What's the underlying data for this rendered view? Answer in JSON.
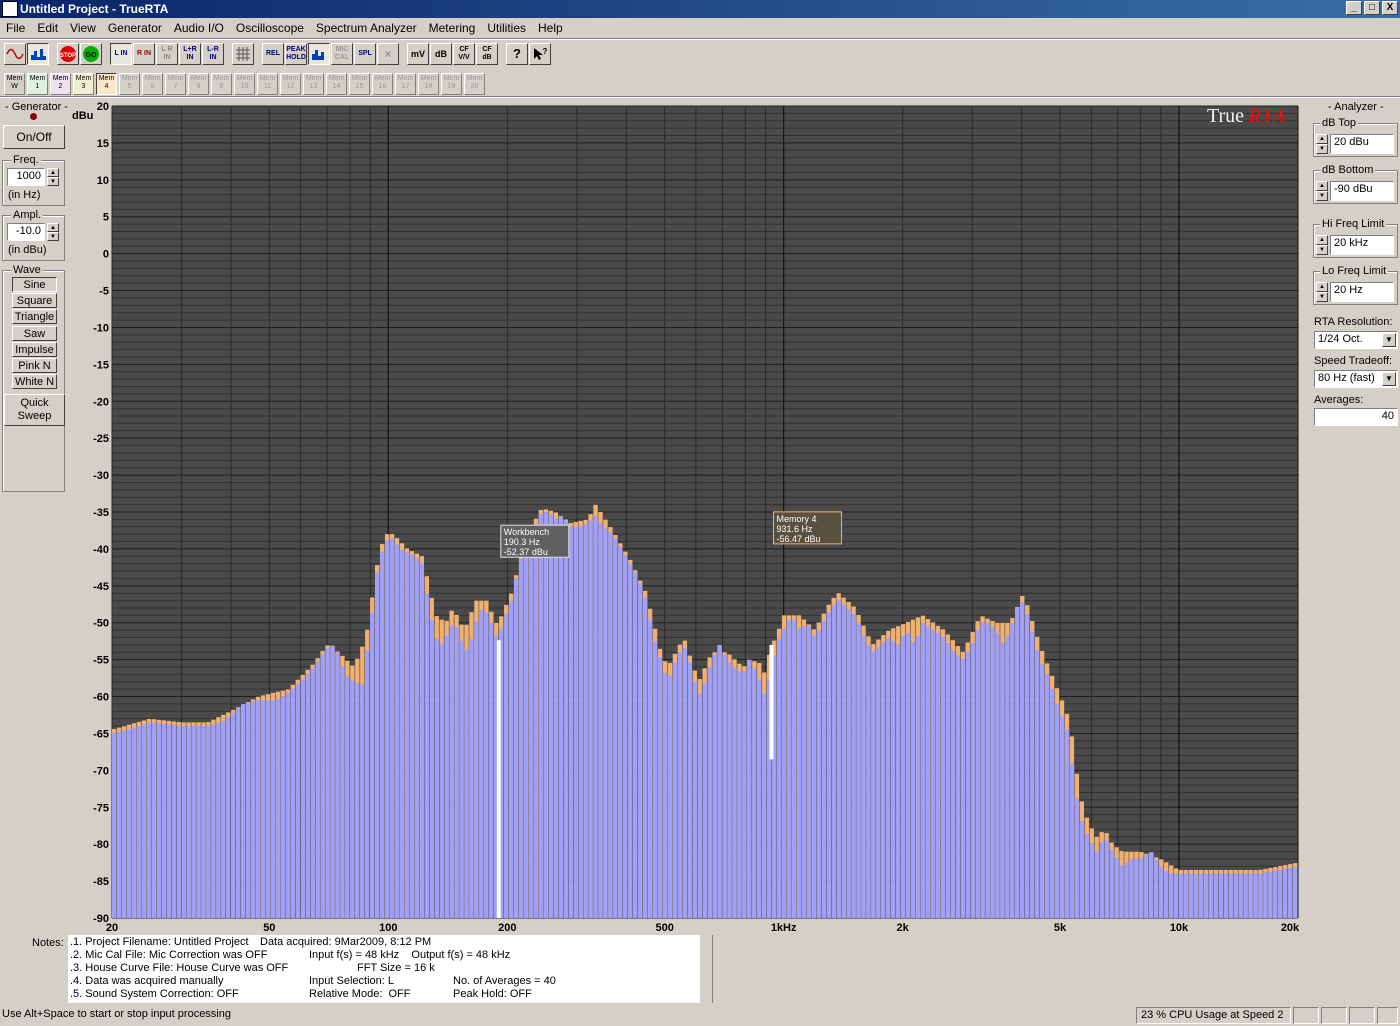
{
  "window": {
    "title": "Untitled Project - TrueRTA",
    "buttons": [
      "_",
      "□",
      "X"
    ]
  },
  "menu": [
    "File",
    "Edit",
    "View",
    "Generator",
    "Audio I/O",
    "Oscilloscope",
    "Spectrum Analyzer",
    "Metering",
    "Utilities",
    "Help"
  ],
  "toolbar": {
    "view_buttons": [
      "sine-wave-icon",
      "spectrum-icon"
    ],
    "control_buttons": [
      "STOP",
      "GO"
    ],
    "input_buttons": [
      "L IN",
      "R IN",
      "L R IN",
      "L+R IN",
      "L-R IN"
    ],
    "grid_button": "grid-icon",
    "mode_buttons": [
      "REL",
      "PEAK HOLD",
      "bars-icon",
      "MIC CAL",
      "SPL",
      "×"
    ],
    "unit_buttons": [
      "mV",
      "dB",
      "CF V/V",
      "CF dB"
    ],
    "help_buttons": [
      "?",
      "help-pointer-icon"
    ]
  },
  "memory_buttons": [
    "Mem W",
    "Mem 1",
    "Mem 2",
    "Mem 3",
    "Mem 4",
    "Mem 5",
    "Mem 6",
    "Mem 7",
    "Mem 8",
    "Mem 9",
    "Mem 10",
    "Mem 11",
    "Mem 12",
    "Mem 13",
    "Mem 14",
    "Mem 15",
    "Mem 16",
    "Mem 17",
    "Mem 18",
    "Mem 19",
    "Mem 20"
  ],
  "generator": {
    "title": "- Generator -",
    "onoff": "On/Off",
    "freq_title": "Freq.",
    "freq_value": "1000",
    "freq_unit": "(in Hz)",
    "ampl_title": "Ampl.",
    "ampl_value": "-10.0",
    "ampl_unit": "(in dBu)",
    "wave_title": "Wave",
    "waves": [
      "Sine",
      "Square",
      "Triangle",
      "Saw",
      "Impulse",
      "Pink N",
      "White N"
    ],
    "quick_sweep": "Quick Sweep"
  },
  "analyzer": {
    "title": "- Analyzer -",
    "db_top_label": "dB Top",
    "db_top": "20 dBu",
    "db_bottom_label": "dB Bottom",
    "db_bottom": "-90 dBu",
    "hi_freq_label": "Hi Freq Limit",
    "hi_freq": "20 kHz",
    "lo_freq_label": "Lo Freq Limit",
    "lo_freq": "20 Hz",
    "resolution_label": "RTA Resolution:",
    "resolution": "1/24 Oct.",
    "speed_label": "Speed Tradeoff:",
    "speed": "80 Hz (fast)",
    "averages_label": "Averages:",
    "averages": "40"
  },
  "chart_data": {
    "type": "bar",
    "ylabel": "dBu",
    "logo": "TrueRTA",
    "ylim": [
      -90,
      20
    ],
    "y_ticks": [
      20,
      15,
      10,
      5,
      0,
      -5,
      -10,
      -15,
      -20,
      -25,
      -30,
      -35,
      -40,
      -45,
      -50,
      -55,
      -60,
      -65,
      -70,
      -75,
      -80,
      -85,
      -90
    ],
    "x_scale": "log",
    "xlim": [
      20,
      20000
    ],
    "x_ticks": [
      {
        "value": 20,
        "label": "20"
      },
      {
        "value": 50,
        "label": "50"
      },
      {
        "value": 100,
        "label": "100"
      },
      {
        "value": 200,
        "label": "200"
      },
      {
        "value": 500,
        "label": "500"
      },
      {
        "value": 1000,
        "label": "1kHz"
      },
      {
        "value": 2000,
        "label": "2k"
      },
      {
        "value": 5000,
        "label": "5k"
      },
      {
        "value": 10000,
        "label": "10k"
      },
      {
        "value": 20000,
        "label": "20k"
      }
    ],
    "colors": {
      "background": "#4a4a4a",
      "grid_major": "#1a1a1a",
      "grid_minor": "#2e2e2e",
      "workbench": "#a0a0f8",
      "memory": "#f0b070"
    },
    "series": [
      {
        "name": "Workbench",
        "points": [
          [
            20,
            -65
          ],
          [
            22,
            -64.5
          ],
          [
            25,
            -63.5
          ],
          [
            30,
            -64
          ],
          [
            35,
            -64
          ],
          [
            38,
            -63.5
          ],
          [
            40,
            -62.5
          ],
          [
            43,
            -61
          ],
          [
            47,
            -60.5
          ],
          [
            52,
            -60.5
          ],
          [
            56,
            -59.5
          ],
          [
            60,
            -58
          ],
          [
            65,
            -56
          ],
          [
            70,
            -53.5
          ],
          [
            73,
            -53
          ],
          [
            75,
            -54.5
          ],
          [
            78,
            -57
          ],
          [
            82,
            -58
          ],
          [
            86,
            -58.5
          ],
          [
            88,
            -55
          ],
          [
            91,
            -49
          ],
          [
            94,
            -43
          ],
          [
            98,
            -39
          ],
          [
            103,
            -38.5
          ],
          [
            107,
            -40
          ],
          [
            112,
            -40.5
          ],
          [
            117,
            -41
          ],
          [
            122,
            -42
          ],
          [
            127,
            -48
          ],
          [
            132,
            -52
          ],
          [
            136,
            -53
          ],
          [
            140,
            -52
          ],
          [
            146,
            -50
          ],
          [
            151,
            -51
          ],
          [
            156,
            -54
          ],
          [
            161,
            -53
          ],
          [
            167,
            -50
          ],
          [
            173,
            -48
          ],
          [
            180,
            -49
          ],
          [
            185,
            -51
          ],
          [
            190.3,
            -52.37
          ],
          [
            195,
            -50
          ],
          [
            205,
            -47
          ],
          [
            215,
            -42
          ],
          [
            225,
            -39
          ],
          [
            235,
            -37
          ],
          [
            245,
            -35
          ],
          [
            255,
            -35
          ],
          [
            265,
            -36
          ],
          [
            275,
            -35.5
          ],
          [
            290,
            -37
          ],
          [
            305,
            -37
          ],
          [
            320,
            -36.5
          ],
          [
            335,
            -35.5
          ],
          [
            350,
            -37
          ],
          [
            370,
            -38
          ],
          [
            390,
            -40
          ],
          [
            410,
            -42
          ],
          [
            430,
            -44
          ],
          [
            450,
            -47
          ],
          [
            470,
            -52
          ],
          [
            490,
            -55
          ],
          [
            510,
            -58
          ],
          [
            535,
            -55
          ],
          [
            560,
            -53
          ],
          [
            585,
            -56
          ],
          [
            610,
            -60
          ],
          [
            635,
            -58
          ],
          [
            660,
            -55
          ],
          [
            690,
            -53
          ],
          [
            720,
            -55
          ],
          [
            750,
            -56
          ],
          [
            790,
            -57
          ],
          [
            820,
            -55
          ],
          [
            860,
            -57
          ],
          [
            900,
            -60
          ],
          [
            931.6,
            -56.47
          ],
          [
            960,
            -53
          ],
          [
            1000,
            -51
          ],
          [
            1050,
            -49
          ],
          [
            1100,
            -51
          ],
          [
            1150,
            -50
          ],
          [
            1200,
            -52
          ],
          [
            1260,
            -50
          ],
          [
            1320,
            -48
          ],
          [
            1380,
            -47
          ],
          [
            1450,
            -48
          ],
          [
            1520,
            -49
          ],
          [
            1600,
            -52
          ],
          [
            1680,
            -54
          ],
          [
            1760,
            -53
          ],
          [
            1850,
            -52
          ],
          [
            1950,
            -53
          ],
          [
            2050,
            -51
          ],
          [
            2150,
            -53
          ],
          [
            2250,
            -50
          ],
          [
            2400,
            -51
          ],
          [
            2550,
            -52
          ],
          [
            2700,
            -54
          ],
          [
            2850,
            -55
          ],
          [
            3000,
            -53
          ],
          [
            3150,
            -50
          ],
          [
            3300,
            -50
          ],
          [
            3450,
            -51
          ],
          [
            3600,
            -53
          ],
          [
            3750,
            -51
          ],
          [
            3900,
            -48
          ],
          [
            4050,
            -47
          ],
          [
            4250,
            -51
          ],
          [
            4450,
            -55
          ],
          [
            4650,
            -57
          ],
          [
            4850,
            -60
          ],
          [
            5000,
            -62
          ],
          [
            5200,
            -64
          ],
          [
            5400,
            -70
          ],
          [
            5600,
            -76
          ],
          [
            5900,
            -79
          ],
          [
            6200,
            -81
          ],
          [
            6500,
            -79
          ],
          [
            6800,
            -81
          ],
          [
            7200,
            -83
          ],
          [
            7600,
            -82
          ],
          [
            8000,
            -82
          ],
          [
            8500,
            -81
          ],
          [
            9000,
            -83
          ],
          [
            9500,
            -84
          ],
          [
            10000,
            -84
          ],
          [
            11000,
            -84
          ],
          [
            12500,
            -84
          ],
          [
            14000,
            -84
          ],
          [
            16000,
            -84
          ],
          [
            18000,
            -83.5
          ],
          [
            20000,
            -83
          ]
        ]
      },
      {
        "name": "Memory 4",
        "points": [
          [
            20,
            -64.5
          ],
          [
            25,
            -63
          ],
          [
            30,
            -63.5
          ],
          [
            35,
            -63.5
          ],
          [
            40,
            -62
          ],
          [
            47,
            -60
          ],
          [
            56,
            -59
          ],
          [
            65,
            -55.5
          ],
          [
            70,
            -53
          ],
          [
            75,
            -54
          ],
          [
            82,
            -56
          ],
          [
            88,
            -52
          ],
          [
            94,
            -42
          ],
          [
            98,
            -38
          ],
          [
            103,
            -38
          ],
          [
            112,
            -40
          ],
          [
            122,
            -41
          ],
          [
            127,
            -45
          ],
          [
            132,
            -49
          ],
          [
            140,
            -50
          ],
          [
            146,
            -48
          ],
          [
            156,
            -51
          ],
          [
            167,
            -47
          ],
          [
            180,
            -47
          ],
          [
            185,
            -50
          ],
          [
            190.3,
            -50
          ],
          [
            205,
            -46
          ],
          [
            225,
            -38
          ],
          [
            245,
            -34.5
          ],
          [
            265,
            -35
          ],
          [
            290,
            -36.5
          ],
          [
            320,
            -36
          ],
          [
            335,
            -34
          ],
          [
            370,
            -37.5
          ],
          [
            410,
            -41.5
          ],
          [
            450,
            -46
          ],
          [
            490,
            -54
          ],
          [
            510,
            -56
          ],
          [
            560,
            -52
          ],
          [
            610,
            -58
          ],
          [
            660,
            -54
          ],
          [
            720,
            -54
          ],
          [
            790,
            -56
          ],
          [
            860,
            -55
          ],
          [
            900,
            -57
          ],
          [
            931.6,
            -53
          ],
          [
            960,
            -52
          ],
          [
            1000,
            -49
          ],
          [
            1100,
            -49
          ],
          [
            1200,
            -51
          ],
          [
            1320,
            -47
          ],
          [
            1380,
            -46
          ],
          [
            1520,
            -48
          ],
          [
            1680,
            -53
          ],
          [
            1850,
            -51
          ],
          [
            2050,
            -50
          ],
          [
            2250,
            -49
          ],
          [
            2550,
            -51
          ],
          [
            2850,
            -54
          ],
          [
            3150,
            -49
          ],
          [
            3450,
            -50
          ],
          [
            3750,
            -50
          ],
          [
            4050,
            -46
          ],
          [
            4450,
            -53
          ],
          [
            4850,
            -58
          ],
          [
            5200,
            -62
          ],
          [
            5400,
            -66
          ],
          [
            5600,
            -73
          ],
          [
            5900,
            -77
          ],
          [
            6200,
            -79
          ],
          [
            6500,
            -78
          ],
          [
            6800,
            -80
          ],
          [
            7200,
            -81
          ],
          [
            8000,
            -81
          ],
          [
            9000,
            -82
          ],
          [
            10000,
            -83.5
          ],
          [
            12500,
            -83.5
          ],
          [
            16000,
            -83.5
          ],
          [
            20000,
            -82.5
          ]
        ]
      }
    ],
    "markers": [
      {
        "name": "Workbench",
        "freq_label": "190.3 Hz",
        "level_label": "-52.37 dBu",
        "freq": 190.3
      },
      {
        "name": "Memory 4",
        "freq_label": "931.6 Hz",
        "level_label": "-56.47 dBu",
        "freq": 931.6
      }
    ]
  },
  "notes": {
    "label": "Notes:",
    "lines": [
      ".1. Project Filename: Untitled Project",
      "Data acquired: 9Mar2009, 8:12 PM",
      ".2. Mic Cal File: Mic Correction was OFF",
      "Input f(s) = 48 kHz    Output f(s) = 48 kHz",
      ".3. House Curve File: House Curve was OFF",
      "FFT Size = 16 k",
      ".4. Data was acquired manually",
      "Input Selection: L",
      "No. of Averages = 40",
      ".5. Sound System Correction: OFF",
      "Relative Mode:  OFF",
      "Peak Hold: OFF"
    ]
  },
  "status": {
    "hint": "Use Alt+Space to start or stop input processing",
    "cpu": "23 % CPU Usage at Speed 2"
  }
}
